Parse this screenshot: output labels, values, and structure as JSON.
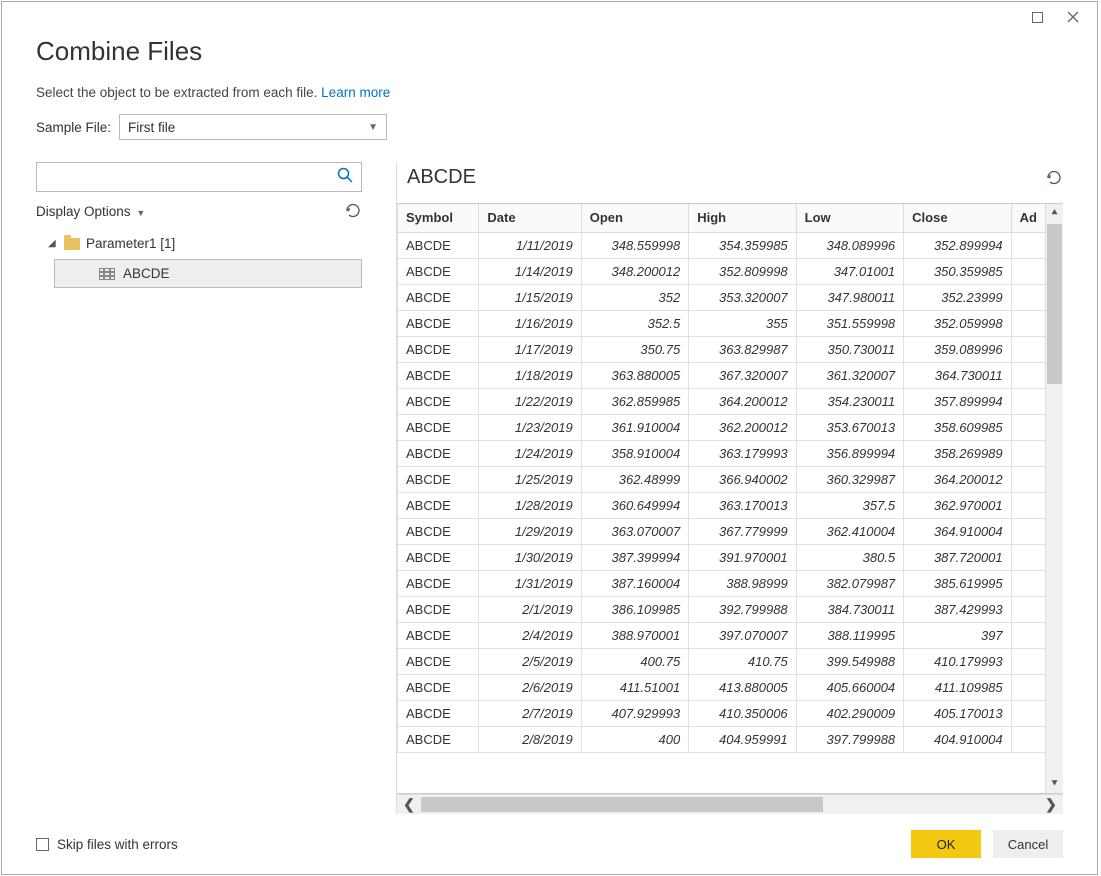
{
  "window": {
    "title": "Combine Files",
    "subtitle": "Select the object to be extracted from each file.",
    "learn_more": "Learn more"
  },
  "sample_file": {
    "label": "Sample File:",
    "value": "First file"
  },
  "search": {
    "placeholder": ""
  },
  "display_options": {
    "label": "Display Options"
  },
  "tree": {
    "folder": "Parameter1 [1]",
    "item": "ABCDE"
  },
  "preview": {
    "title": "ABCDE"
  },
  "table": {
    "columns": [
      "Symbol",
      "Date",
      "Open",
      "High",
      "Low",
      "Close",
      "Ad"
    ],
    "rows": [
      [
        "ABCDE",
        "1/11/2019",
        "348.559998",
        "354.359985",
        "348.089996",
        "352.899994"
      ],
      [
        "ABCDE",
        "1/14/2019",
        "348.200012",
        "352.809998",
        "347.01001",
        "350.359985"
      ],
      [
        "ABCDE",
        "1/15/2019",
        "352",
        "353.320007",
        "347.980011",
        "352.23999"
      ],
      [
        "ABCDE",
        "1/16/2019",
        "352.5",
        "355",
        "351.559998",
        "352.059998"
      ],
      [
        "ABCDE",
        "1/17/2019",
        "350.75",
        "363.829987",
        "350.730011",
        "359.089996"
      ],
      [
        "ABCDE",
        "1/18/2019",
        "363.880005",
        "367.320007",
        "361.320007",
        "364.730011"
      ],
      [
        "ABCDE",
        "1/22/2019",
        "362.859985",
        "364.200012",
        "354.230011",
        "357.899994"
      ],
      [
        "ABCDE",
        "1/23/2019",
        "361.910004",
        "362.200012",
        "353.670013",
        "358.609985"
      ],
      [
        "ABCDE",
        "1/24/2019",
        "358.910004",
        "363.179993",
        "356.899994",
        "358.269989"
      ],
      [
        "ABCDE",
        "1/25/2019",
        "362.48999",
        "366.940002",
        "360.329987",
        "364.200012"
      ],
      [
        "ABCDE",
        "1/28/2019",
        "360.649994",
        "363.170013",
        "357.5",
        "362.970001"
      ],
      [
        "ABCDE",
        "1/29/2019",
        "363.070007",
        "367.779999",
        "362.410004",
        "364.910004"
      ],
      [
        "ABCDE",
        "1/30/2019",
        "387.399994",
        "391.970001",
        "380.5",
        "387.720001"
      ],
      [
        "ABCDE",
        "1/31/2019",
        "387.160004",
        "388.98999",
        "382.079987",
        "385.619995"
      ],
      [
        "ABCDE",
        "2/1/2019",
        "386.109985",
        "392.799988",
        "384.730011",
        "387.429993"
      ],
      [
        "ABCDE",
        "2/4/2019",
        "388.970001",
        "397.070007",
        "388.119995",
        "397"
      ],
      [
        "ABCDE",
        "2/5/2019",
        "400.75",
        "410.75",
        "399.549988",
        "410.179993"
      ],
      [
        "ABCDE",
        "2/6/2019",
        "411.51001",
        "413.880005",
        "405.660004",
        "411.109985"
      ],
      [
        "ABCDE",
        "2/7/2019",
        "407.929993",
        "410.350006",
        "402.290009",
        "405.170013"
      ],
      [
        "ABCDE",
        "2/8/2019",
        "400",
        "404.959991",
        "397.799988",
        "404.910004"
      ]
    ]
  },
  "footer": {
    "skip_errors": "Skip files with errors",
    "ok": "OK",
    "cancel": "Cancel"
  }
}
